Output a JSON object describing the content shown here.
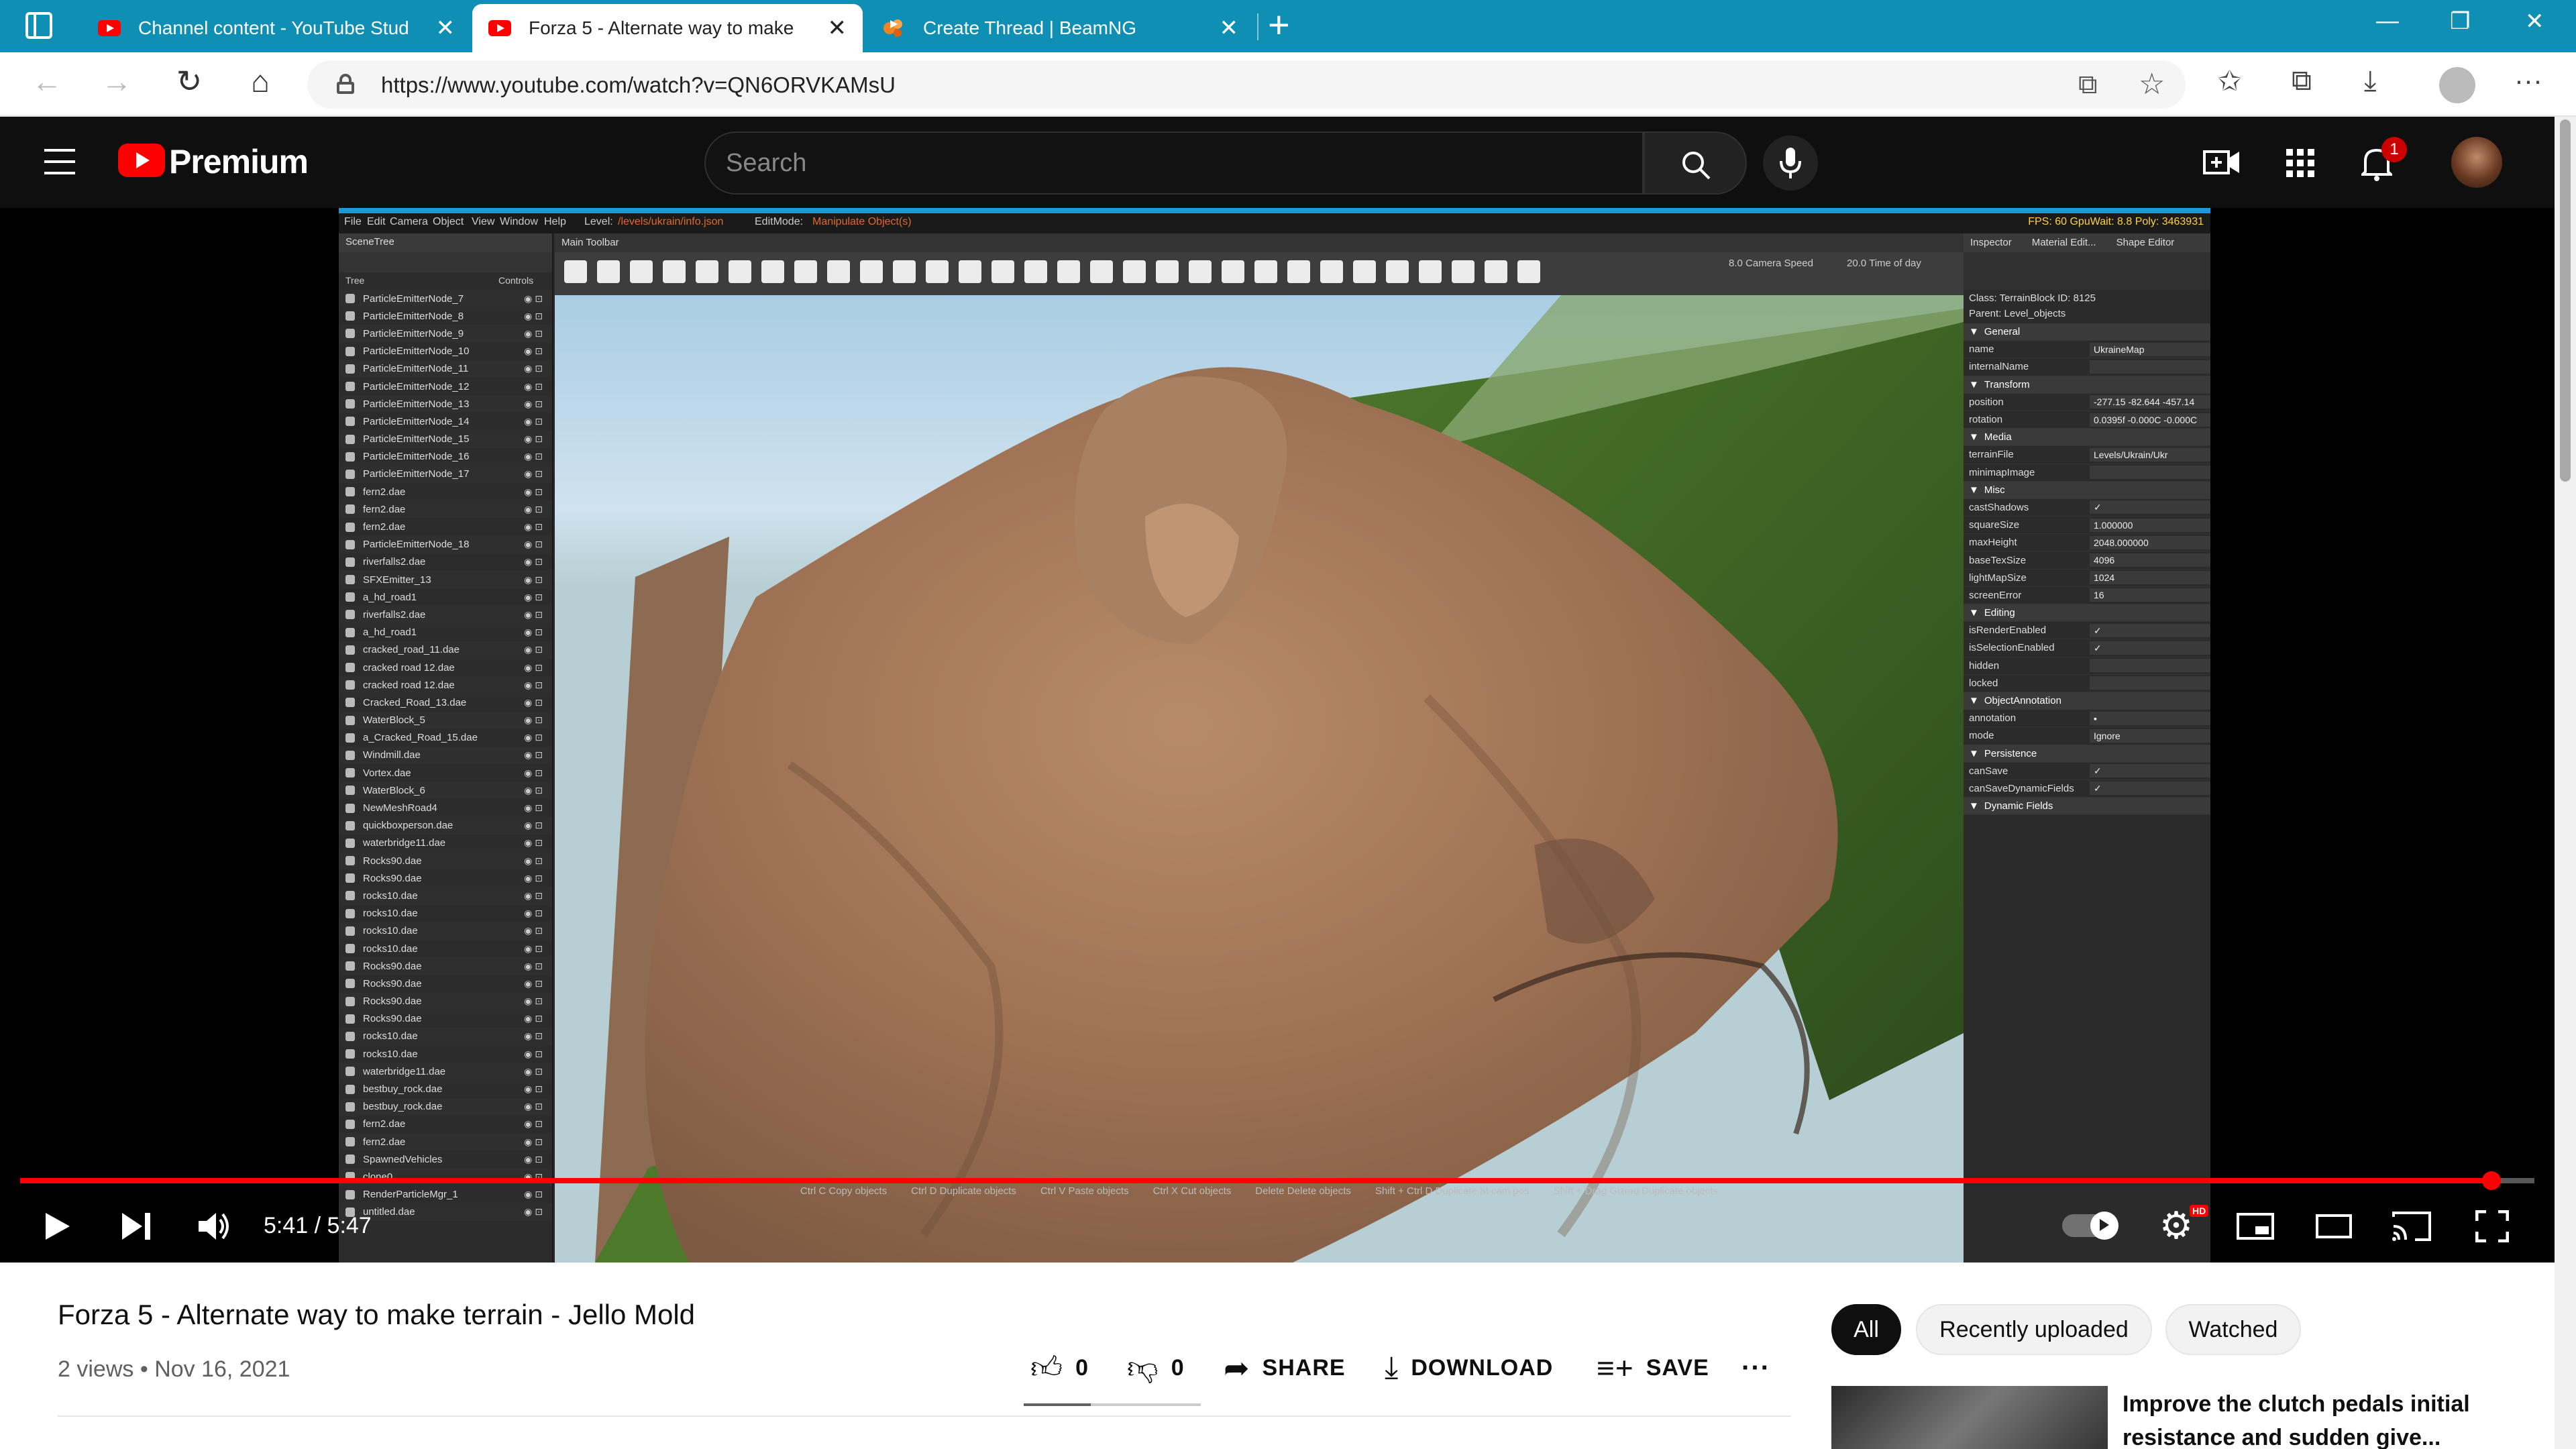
{
  "browser": {
    "tabs": [
      {
        "title": "Channel content - YouTube Stud",
        "close": "✕"
      },
      {
        "title": "Forza 5 - Alternate way to make",
        "close": "✕"
      },
      {
        "title": "Create Thread | BeamNG",
        "close": "✕"
      }
    ],
    "new_tab": "+",
    "window_controls": {
      "minimize": "—",
      "restore": "❐",
      "close": "✕"
    },
    "url": "https://www.youtube.com/watch?v=QN6ORVKAMsU"
  },
  "youtube": {
    "logo_text": "Premium",
    "search_placeholder": "Search",
    "notification_count": "1"
  },
  "editor": {
    "menus": [
      "File",
      "Edit",
      "Camera",
      "Object",
      "View",
      "Window",
      "Help"
    ],
    "level_label": "Level:",
    "level_value": "/levels/ukrain/info.json",
    "editmode_label": "EditMode:",
    "editmode_value": "Manipulate Object(s)",
    "fps": "FPS: 60 GpuWait: 8.8 Poly: 3463931",
    "scenetree_title": "SceneTree",
    "main_toolbar_title": "Main Toolbar",
    "camera_speed": "8.0 Camera Speed",
    "time_of_day": "20.0   Time of day",
    "tree_header": {
      "tree": "Tree",
      "controls": "Controls"
    },
    "tree_items": [
      "ParticleEmitterNode_7",
      "ParticleEmitterNode_8",
      "ParticleEmitterNode_9",
      "ParticleEmitterNode_10",
      "ParticleEmitterNode_11",
      "ParticleEmitterNode_12",
      "ParticleEmitterNode_13",
      "ParticleEmitterNode_14",
      "ParticleEmitterNode_15",
      "ParticleEmitterNode_16",
      "ParticleEmitterNode_17",
      "fern2.dae",
      "fern2.dae",
      "fern2.dae",
      "ParticleEmitterNode_18",
      "riverfalls2.dae",
      "SFXEmitter_13",
      "a_hd_road1",
      "riverfalls2.dae",
      "a_hd_road1",
      "cracked_road_11.dae",
      "cracked road 12.dae",
      "cracked road 12.dae",
      "Cracked_Road_13.dae",
      "WaterBlock_5",
      "a_Cracked_Road_15.dae",
      "Windmill.dae",
      "Vortex.dae",
      "WaterBlock_6",
      "NewMeshRoad4",
      "quickboxperson.dae",
      "waterbridge11.dae",
      "Rocks90.dae",
      "Rocks90.dae",
      "rocks10.dae",
      "rocks10.dae",
      "rocks10.dae",
      "rocks10.dae",
      "Rocks90.dae",
      "Rocks90.dae",
      "Rocks90.dae",
      "Rocks90.dae",
      "rocks10.dae",
      "rocks10.dae",
      "waterbridge11.dae",
      "bestbuy_rock.dae",
      "bestbuy_rock.dae",
      "fern2.dae",
      "fern2.dae",
      "SpawnedVehicles",
      "clone0",
      "RenderParticleMgr_1",
      "untitled.dae"
    ],
    "inspector_tabs": [
      "Inspector",
      "Material Edit...",
      "Shape Editor"
    ],
    "class_line": "Class: TerrainBlock   ID: 8125",
    "parent_line": "Parent: Level_objects",
    "inspector_rows": [
      {
        "k": "General",
        "v": "",
        "sec": true
      },
      {
        "k": "name",
        "v": "UkraineMap"
      },
      {
        "k": "internalName",
        "v": ""
      },
      {
        "k": "Transform",
        "v": "",
        "sec": true
      },
      {
        "k": "position",
        "v": "-277.15  -82.644  -457.14"
      },
      {
        "k": "rotation",
        "v": "0.0395f  -0.000C  -0.000C"
      },
      {
        "k": "Media",
        "v": "",
        "sec": true
      },
      {
        "k": "terrainFile",
        "v": "Levels/Ukrain/Ukr"
      },
      {
        "k": "minimapImage",
        "v": ""
      },
      {
        "k": "Misc",
        "v": "",
        "sec": true
      },
      {
        "k": "castShadows",
        "v": "✓"
      },
      {
        "k": "squareSize",
        "v": "1.000000"
      },
      {
        "k": "maxHeight",
        "v": "2048.000000"
      },
      {
        "k": "baseTexSize",
        "v": "4096"
      },
      {
        "k": "lightMapSize",
        "v": "1024"
      },
      {
        "k": "screenError",
        "v": "16"
      },
      {
        "k": "Editing",
        "v": "",
        "sec": true
      },
      {
        "k": "isRenderEnabled",
        "v": "✓"
      },
      {
        "k": "isSelectionEnabled",
        "v": "✓"
      },
      {
        "k": "hidden",
        "v": ""
      },
      {
        "k": "locked",
        "v": ""
      },
      {
        "k": "ObjectAnnotation",
        "v": "",
        "sec": true
      },
      {
        "k": "annotation",
        "v": "▪"
      },
      {
        "k": "mode",
        "v": "Ignore"
      },
      {
        "k": "Persistence",
        "v": "",
        "sec": true
      },
      {
        "k": "canSave",
        "v": "✓"
      },
      {
        "k": "canSaveDynamicFields",
        "v": "✓"
      },
      {
        "k": "Dynamic Fields",
        "v": "",
        "sec": true
      }
    ],
    "shortcuts": [
      "Ctrl C  Copy objects",
      "Ctrl D  Duplicate objects",
      "Ctrl V  Paste objects",
      "Ctrl X  Cut objects",
      "Delete  Delete objects",
      "Shift + Ctrl D  Duplicate at cam pos",
      "Shift + Drag Gizmo  Duplicate objects"
    ]
  },
  "player": {
    "current_time": "5:41",
    "duration": "5:47",
    "progress_fraction": 0.983,
    "hd_badge": "HD"
  },
  "video": {
    "title": "Forza 5 - Alternate way to make terrain - Jello Mold",
    "views": "2 views",
    "date": "Nov 16, 2021",
    "likes": "0",
    "dislikes": "0",
    "share": "SHARE",
    "download": "DOWNLOAD",
    "save": "SAVE",
    "more": "···"
  },
  "sidebar": {
    "chips": [
      "All",
      "Recently uploaded",
      "Watched"
    ],
    "recommendation_title": "Improve the clutch pedals initial resistance and sudden give..."
  },
  "colors": {
    "tab_strip": "#0f8fb4",
    "yt_red": "#ff0000",
    "yt_dark": "#0f0f0f"
  }
}
